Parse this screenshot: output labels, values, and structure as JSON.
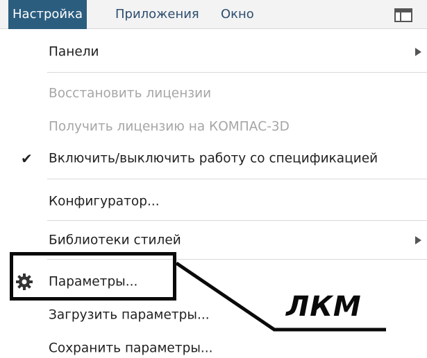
{
  "menubar": {
    "items": [
      {
        "label": "Настройка",
        "active": true
      },
      {
        "label": "Приложения",
        "active": false
      },
      {
        "label": "Окно",
        "active": false
      }
    ],
    "window_icon": "window-layout-icon"
  },
  "menu": {
    "items": [
      {
        "label": "Панели",
        "enabled": true,
        "submenu": true
      },
      {
        "label": "Восстановить лицензии",
        "enabled": false
      },
      {
        "label": "Получить лицензию на КОМПАС-3D",
        "enabled": false
      },
      {
        "label": "Включить/выключить работу со спецификацией",
        "enabled": true,
        "checked": true
      },
      {
        "label": "Конфигуратор...",
        "enabled": true
      },
      {
        "label": "Библиотеки стилей",
        "enabled": true,
        "submenu": true
      },
      {
        "label": "Параметры...",
        "enabled": true,
        "icon": "gear-icon"
      },
      {
        "label": "Загрузить параметры...",
        "enabled": true
      },
      {
        "label": "Сохранить параметры...",
        "enabled": true
      }
    ]
  },
  "annotation": {
    "label": "ЛКМ"
  },
  "colors": {
    "active_menu_bg": "#2b5d7f",
    "disabled_text": "#a6a6a6",
    "menubar_text": "#2d4d6e"
  }
}
